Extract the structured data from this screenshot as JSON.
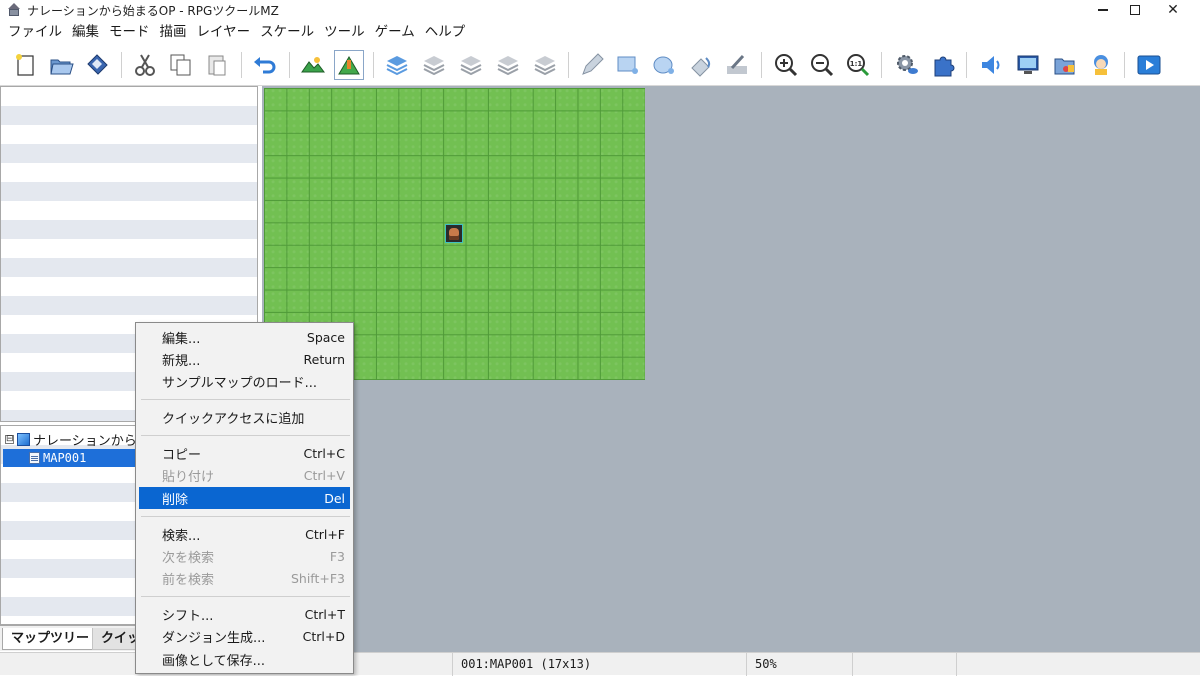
{
  "window": {
    "title": "ナレーションから始まるOP - RPGツクールMZ",
    "minimize": "─",
    "close": "✕"
  },
  "menubar": [
    "ファイル",
    "編集",
    "モード",
    "描画",
    "レイヤー",
    "スケール",
    "ツール",
    "ゲーム",
    "ヘルプ"
  ],
  "toolbar": {
    "icons": [
      "new-project-icon",
      "open-project-icon",
      "save-project-icon",
      "cut-icon",
      "copy-icon",
      "paste-icon",
      "undo-icon",
      "map-mode-icon",
      "event-mode-icon",
      "layer-1-icon",
      "layer-2-icon",
      "layer-3-icon",
      "layer-4-icon",
      "auto-layer-icon",
      "pencil-icon",
      "rectangle-icon",
      "ellipse-icon",
      "flood-fill-icon",
      "shadow-pen-icon",
      "zoom-in-icon",
      "zoom-out-icon",
      "actual-size-icon",
      "database-icon",
      "plugin-manager-icon",
      "sound-test-icon",
      "event-searcher-icon",
      "resource-manager-icon",
      "character-generator-icon",
      "playtest-icon"
    ],
    "zoom_1to1_label": "1:1"
  },
  "map_tree": {
    "root_label": "ナレーションから",
    "expander": "⊟",
    "map_label": "MAP001"
  },
  "bottom_tabs": {
    "map_tree": "マップツリー",
    "quick": "クイッ"
  },
  "context_menu": {
    "items": [
      {
        "label": "編集...",
        "shortcut": "Space",
        "enabled": true
      },
      {
        "label": "新規...",
        "shortcut": "Return",
        "enabled": true
      },
      {
        "label": "サンプルマップのロード...",
        "shortcut": "",
        "enabled": true
      },
      {
        "label": "クイックアクセスに追加",
        "shortcut": "",
        "enabled": true
      },
      {
        "label": "コピー",
        "shortcut": "Ctrl+C",
        "enabled": true
      },
      {
        "label": "貼り付け",
        "shortcut": "Ctrl+V",
        "enabled": false
      },
      {
        "label": "削除",
        "shortcut": "Del",
        "enabled": true,
        "highlighted": true
      },
      {
        "label": "検索...",
        "shortcut": "Ctrl+F",
        "enabled": true
      },
      {
        "label": "次を検索",
        "shortcut": "F3",
        "enabled": false
      },
      {
        "label": "前を検索",
        "shortcut": "Shift+F3",
        "enabled": false
      },
      {
        "label": "シフト...",
        "shortcut": "Ctrl+T",
        "enabled": true
      },
      {
        "label": "ダンジョン生成...",
        "shortcut": "Ctrl+D",
        "enabled": true
      },
      {
        "label": "画像として保存...",
        "shortcut": "",
        "enabled": true
      }
    ]
  },
  "map": {
    "name": "MAP001",
    "width_tiles": 17,
    "height_tiles": 13
  },
  "statusbar": {
    "map_info": "001:MAP001 (17x13)",
    "zoom": "50%"
  },
  "colors": {
    "grass": "#72c052",
    "canvas_bg": "#a9b2bc",
    "selection": "#1e6fd9",
    "menu_highlight": "#0a66d1"
  }
}
